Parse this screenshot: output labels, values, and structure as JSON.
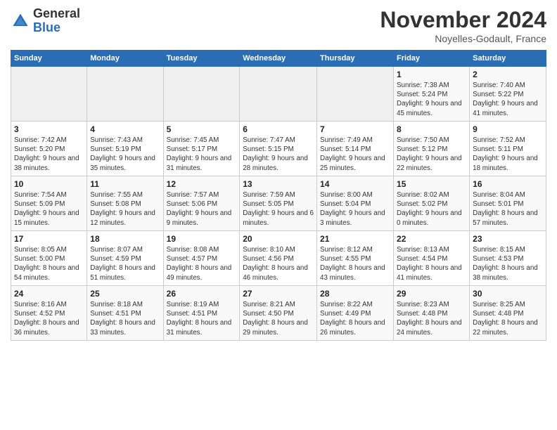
{
  "logo": {
    "general": "General",
    "blue": "Blue"
  },
  "title": "November 2024",
  "subtitle": "Noyelles-Godault, France",
  "days_of_week": [
    "Sunday",
    "Monday",
    "Tuesday",
    "Wednesday",
    "Thursday",
    "Friday",
    "Saturday"
  ],
  "weeks": [
    [
      {
        "day": "",
        "sunrise": "",
        "sunset": "",
        "daylight": ""
      },
      {
        "day": "",
        "sunrise": "",
        "sunset": "",
        "daylight": ""
      },
      {
        "day": "",
        "sunrise": "",
        "sunset": "",
        "daylight": ""
      },
      {
        "day": "",
        "sunrise": "",
        "sunset": "",
        "daylight": ""
      },
      {
        "day": "",
        "sunrise": "",
        "sunset": "",
        "daylight": ""
      },
      {
        "day": "1",
        "sunrise": "Sunrise: 7:38 AM",
        "sunset": "Sunset: 5:24 PM",
        "daylight": "Daylight: 9 hours and 45 minutes."
      },
      {
        "day": "2",
        "sunrise": "Sunrise: 7:40 AM",
        "sunset": "Sunset: 5:22 PM",
        "daylight": "Daylight: 9 hours and 41 minutes."
      }
    ],
    [
      {
        "day": "3",
        "sunrise": "Sunrise: 7:42 AM",
        "sunset": "Sunset: 5:20 PM",
        "daylight": "Daylight: 9 hours and 38 minutes."
      },
      {
        "day": "4",
        "sunrise": "Sunrise: 7:43 AM",
        "sunset": "Sunset: 5:19 PM",
        "daylight": "Daylight: 9 hours and 35 minutes."
      },
      {
        "day": "5",
        "sunrise": "Sunrise: 7:45 AM",
        "sunset": "Sunset: 5:17 PM",
        "daylight": "Daylight: 9 hours and 31 minutes."
      },
      {
        "day": "6",
        "sunrise": "Sunrise: 7:47 AM",
        "sunset": "Sunset: 5:15 PM",
        "daylight": "Daylight: 9 hours and 28 minutes."
      },
      {
        "day": "7",
        "sunrise": "Sunrise: 7:49 AM",
        "sunset": "Sunset: 5:14 PM",
        "daylight": "Daylight: 9 hours and 25 minutes."
      },
      {
        "day": "8",
        "sunrise": "Sunrise: 7:50 AM",
        "sunset": "Sunset: 5:12 PM",
        "daylight": "Daylight: 9 hours and 22 minutes."
      },
      {
        "day": "9",
        "sunrise": "Sunrise: 7:52 AM",
        "sunset": "Sunset: 5:11 PM",
        "daylight": "Daylight: 9 hours and 18 minutes."
      }
    ],
    [
      {
        "day": "10",
        "sunrise": "Sunrise: 7:54 AM",
        "sunset": "Sunset: 5:09 PM",
        "daylight": "Daylight: 9 hours and 15 minutes."
      },
      {
        "day": "11",
        "sunrise": "Sunrise: 7:55 AM",
        "sunset": "Sunset: 5:08 PM",
        "daylight": "Daylight: 9 hours and 12 minutes."
      },
      {
        "day": "12",
        "sunrise": "Sunrise: 7:57 AM",
        "sunset": "Sunset: 5:06 PM",
        "daylight": "Daylight: 9 hours and 9 minutes."
      },
      {
        "day": "13",
        "sunrise": "Sunrise: 7:59 AM",
        "sunset": "Sunset: 5:05 PM",
        "daylight": "Daylight: 9 hours and 6 minutes."
      },
      {
        "day": "14",
        "sunrise": "Sunrise: 8:00 AM",
        "sunset": "Sunset: 5:04 PM",
        "daylight": "Daylight: 9 hours and 3 minutes."
      },
      {
        "day": "15",
        "sunrise": "Sunrise: 8:02 AM",
        "sunset": "Sunset: 5:02 PM",
        "daylight": "Daylight: 9 hours and 0 minutes."
      },
      {
        "day": "16",
        "sunrise": "Sunrise: 8:04 AM",
        "sunset": "Sunset: 5:01 PM",
        "daylight": "Daylight: 8 hours and 57 minutes."
      }
    ],
    [
      {
        "day": "17",
        "sunrise": "Sunrise: 8:05 AM",
        "sunset": "Sunset: 5:00 PM",
        "daylight": "Daylight: 8 hours and 54 minutes."
      },
      {
        "day": "18",
        "sunrise": "Sunrise: 8:07 AM",
        "sunset": "Sunset: 4:59 PM",
        "daylight": "Daylight: 8 hours and 51 minutes."
      },
      {
        "day": "19",
        "sunrise": "Sunrise: 8:08 AM",
        "sunset": "Sunset: 4:57 PM",
        "daylight": "Daylight: 8 hours and 49 minutes."
      },
      {
        "day": "20",
        "sunrise": "Sunrise: 8:10 AM",
        "sunset": "Sunset: 4:56 PM",
        "daylight": "Daylight: 8 hours and 46 minutes."
      },
      {
        "day": "21",
        "sunrise": "Sunrise: 8:12 AM",
        "sunset": "Sunset: 4:55 PM",
        "daylight": "Daylight: 8 hours and 43 minutes."
      },
      {
        "day": "22",
        "sunrise": "Sunrise: 8:13 AM",
        "sunset": "Sunset: 4:54 PM",
        "daylight": "Daylight: 8 hours and 41 minutes."
      },
      {
        "day": "23",
        "sunrise": "Sunrise: 8:15 AM",
        "sunset": "Sunset: 4:53 PM",
        "daylight": "Daylight: 8 hours and 38 minutes."
      }
    ],
    [
      {
        "day": "24",
        "sunrise": "Sunrise: 8:16 AM",
        "sunset": "Sunset: 4:52 PM",
        "daylight": "Daylight: 8 hours and 36 minutes."
      },
      {
        "day": "25",
        "sunrise": "Sunrise: 8:18 AM",
        "sunset": "Sunset: 4:51 PM",
        "daylight": "Daylight: 8 hours and 33 minutes."
      },
      {
        "day": "26",
        "sunrise": "Sunrise: 8:19 AM",
        "sunset": "Sunset: 4:51 PM",
        "daylight": "Daylight: 8 hours and 31 minutes."
      },
      {
        "day": "27",
        "sunrise": "Sunrise: 8:21 AM",
        "sunset": "Sunset: 4:50 PM",
        "daylight": "Daylight: 8 hours and 29 minutes."
      },
      {
        "day": "28",
        "sunrise": "Sunrise: 8:22 AM",
        "sunset": "Sunset: 4:49 PM",
        "daylight": "Daylight: 8 hours and 26 minutes."
      },
      {
        "day": "29",
        "sunrise": "Sunrise: 8:23 AM",
        "sunset": "Sunset: 4:48 PM",
        "daylight": "Daylight: 8 hours and 24 minutes."
      },
      {
        "day": "30",
        "sunrise": "Sunrise: 8:25 AM",
        "sunset": "Sunset: 4:48 PM",
        "daylight": "Daylight: 8 hours and 22 minutes."
      }
    ]
  ]
}
